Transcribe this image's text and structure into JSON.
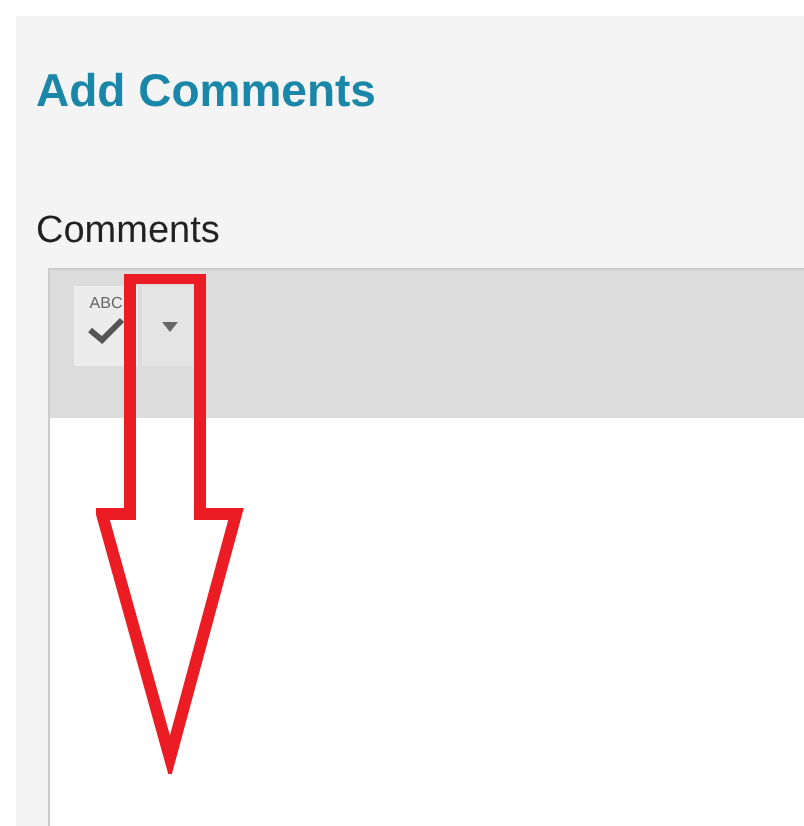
{
  "title": "Add Comments",
  "field": {
    "label": "Comments"
  },
  "toolbar": {
    "spellcheck_label": "ABC"
  }
}
